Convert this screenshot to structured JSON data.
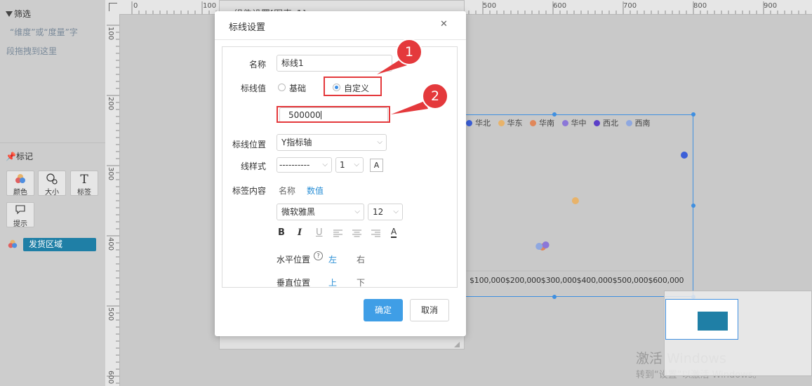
{
  "left_panel": {
    "filter_title": "筛选",
    "filter_hint_line1": "“维度”或“度量”字",
    "filter_hint_line2": "段拖拽到这里",
    "marks_title": "标记",
    "mark_buttons": [
      {
        "label": "颜色",
        "icon": "color-dots-icon"
      },
      {
        "label": "大小",
        "icon": "size-circles-icon"
      },
      {
        "label": "标签",
        "icon": "text-t-icon"
      },
      {
        "label": "提示",
        "icon": "tooltip-bubble-icon"
      }
    ],
    "field_chip": "发货区域"
  },
  "ruler": {
    "top_labels": [
      "0",
      "100",
      "500",
      "600",
      "700",
      "800",
      "900"
    ],
    "left_labels": [
      "100",
      "200",
      "300",
      "400",
      "500",
      "600"
    ]
  },
  "background": {
    "window_title": "组件设置[图表_1]",
    "watermark_line1": "激活 Windows",
    "watermark_line2": "转到“设置”以激活 Windows。"
  },
  "chart_data": {
    "type": "scatter",
    "legend": [
      "华北",
      "华东",
      "华南",
      "华中",
      "西北",
      "西南"
    ],
    "legend_placement": "top",
    "x_tick_labels": [
      "$100,000",
      "$200,000",
      "$300,000",
      "$400,000",
      "$500,000",
      "$600,000"
    ],
    "colors": {
      "华北": "#3b5fd8",
      "华东": "#e8b36a",
      "华南": "#e0875a",
      "华中": "#8b77d8",
      "西北": "#5b3fc8",
      "西南": "#8fa8e0"
    },
    "points": [
      {
        "series": "华北",
        "x": 700000,
        "y": 0
      },
      {
        "series": "华东",
        "x": 370000,
        "y": 0
      },
      {
        "series": "华南",
        "x": 270000,
        "y": 0
      },
      {
        "series": "华中",
        "x": 280000,
        "y": 0
      },
      {
        "series": "西南",
        "x": 260000,
        "y": 0
      }
    ]
  },
  "dialog": {
    "title": "标线设置",
    "close_symbol": "✕",
    "name_label": "名称",
    "name_value": "标线1",
    "value_label": "标线值",
    "radio_basic": "基础",
    "radio_custom": "自定义",
    "custom_value": "500000",
    "position_label": "标线位置",
    "position_value": "Y指标轴",
    "line_style_label": "线样式",
    "line_style_value": "----------",
    "line_width_value": "1",
    "label_content_label": "标签内容",
    "label_opt_name": "名称",
    "label_opt_value": "数值",
    "font_family_value": "微软雅黑",
    "font_size_value": "12",
    "format_bold": "B",
    "format_italic": "I",
    "format_underline": "U",
    "color_a": "A",
    "h_position_label": "水平位置",
    "h_left": "左",
    "h_right": "右",
    "v_position_label": "垂直位置",
    "v_top": "上",
    "v_bottom": "下",
    "confirm_button": "确定",
    "cancel_button": "取消"
  },
  "annotations": {
    "callout_1": "1",
    "callout_2": "2"
  },
  "colors": {
    "accent": "#3f9ee6",
    "annotation_red": "#e4393c",
    "chip_bg": "#1f7fa6",
    "selection_blue": "#3f8fe0"
  }
}
